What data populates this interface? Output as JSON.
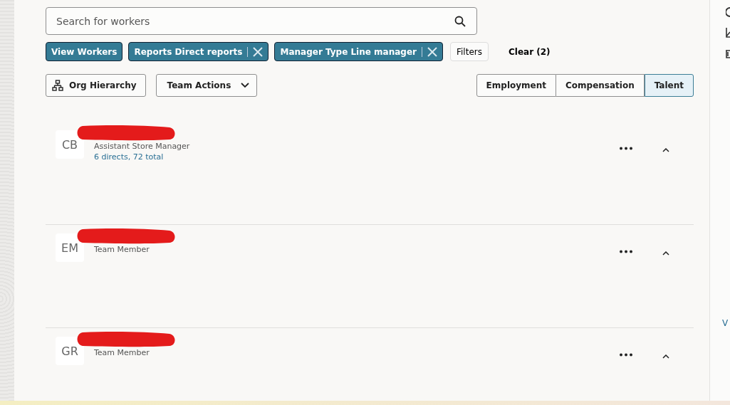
{
  "search": {
    "placeholder": "Search for workers"
  },
  "filters": [
    {
      "label": "View Workers",
      "removable": false
    },
    {
      "label": "Reports Direct reports",
      "removable": true
    },
    {
      "label": "Manager Type Line manager",
      "removable": true
    }
  ],
  "filters_button": "Filters",
  "clear_button": "Clear (2)",
  "org_hierarchy_button": "Org Hierarchy",
  "team_actions_button": "Team Actions",
  "views": [
    {
      "label": "Employment",
      "selected": false
    },
    {
      "label": "Compensation",
      "selected": false
    },
    {
      "label": "Talent",
      "selected": true
    }
  ],
  "workers": [
    {
      "initials": "CB",
      "title": "Assistant Store Manager",
      "reports": "6 directs, 72 total"
    },
    {
      "initials": "EM",
      "title": "Team Member"
    },
    {
      "initials": "GR",
      "title": "Team Member"
    }
  ],
  "side_panel": {
    "link": "V"
  }
}
